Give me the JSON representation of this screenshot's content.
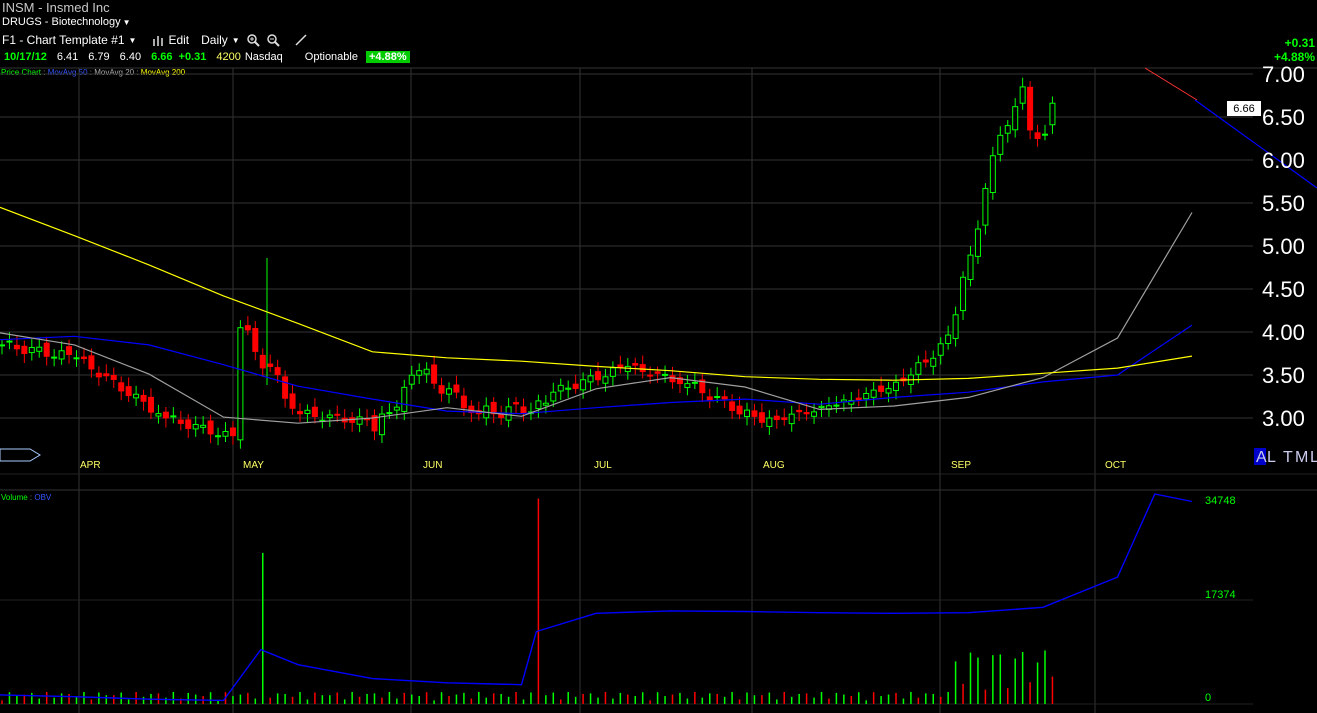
{
  "header": {
    "symbol_line": "INSM - Insmed Inc",
    "industry": "DRUGS - Biotechnology",
    "template": "F1 - Chart Template #1",
    "edit_label": "Edit",
    "period_label": "Daily",
    "price_label": "6.66",
    "price_change_top": "+0.31",
    "price_change_pct_top": "+4.88%"
  },
  "quote": {
    "date": "10/17/12",
    "open": "6.41",
    "high": "6.79",
    "low": "6.40",
    "close": "6.66",
    "change": "+0.31",
    "volume": "4200",
    "exchange": "Nasdaq",
    "optionable": "Optionable",
    "pct_badge": "+4.88%"
  },
  "legend": {
    "price_chart": "Price Chart",
    "ma50": "MovAvg 50",
    "ma20": "MovAvg 20",
    "ma200": "MovAvg 200",
    "volume": "Volume",
    "obv": "OBV"
  },
  "colors": {
    "up": "#00ff00",
    "down": "#ff0000",
    "ma50": "#0000ff",
    "ma20": "#a0a0a0",
    "ma200": "#ffff00",
    "obv": "#0000ff",
    "trendline": "#ff3333",
    "grid": "#333333"
  },
  "chart_data": [
    {
      "type": "line",
      "series": [
        {
          "name": "MovAvg 50",
          "x": [
            0,
            10,
            20,
            30,
            40,
            50,
            60,
            70,
            80,
            90,
            100,
            110,
            120,
            130,
            140,
            150,
            160
          ],
          "values": [
            3.91,
            3.95,
            3.85,
            3.62,
            3.37,
            3.22,
            3.08,
            3.05,
            3.12,
            3.18,
            3.22,
            3.16,
            3.24,
            3.3,
            3.42,
            3.5,
            4.08
          ]
        },
        {
          "name": "MovAvg 20",
          "x": [
            0,
            10,
            20,
            30,
            40,
            50,
            60,
            70,
            80,
            90,
            100,
            110,
            120,
            130,
            140,
            150,
            160
          ],
          "values": [
            3.99,
            3.85,
            3.51,
            3.01,
            2.94,
            3.0,
            3.12,
            3.02,
            3.34,
            3.47,
            3.36,
            3.1,
            3.14,
            3.24,
            3.47,
            3.93,
            5.39
          ]
        },
        {
          "name": "MovAvg 200",
          "x": [
            0,
            10,
            20,
            30,
            40,
            50,
            60,
            70,
            80,
            90,
            100,
            110,
            120,
            130,
            140,
            150,
            160
          ],
          "values": [
            5.45,
            5.12,
            4.78,
            4.42,
            4.1,
            3.77,
            3.7,
            3.66,
            3.6,
            3.55,
            3.48,
            3.45,
            3.44,
            3.46,
            3.52,
            3.58,
            3.72
          ]
        }
      ],
      "candles_approx": {
        "note_months": [
          "APR",
          "MAY",
          "JUN",
          "JUL",
          "AUG",
          "SEP",
          "OCT"
        ],
        "last": {
          "open": 6.41,
          "high": 6.79,
          "low": 6.4,
          "close": 6.66
        }
      },
      "price_ticks": [
        "7.00",
        "6.50",
        "6.00",
        "5.50",
        "5.00",
        "4.50",
        "4.00",
        "3.50",
        "3.00"
      ],
      "ylim": [
        2.8,
        7.1
      ],
      "month_labels": [
        "APR",
        "MAY",
        "JUN",
        "JUL",
        "AUG",
        "SEP",
        "OCT"
      ]
    },
    {
      "type": "line",
      "series": [
        {
          "name": "OBV",
          "x": [
            0,
            10,
            20,
            30,
            35,
            40,
            50,
            60,
            70,
            72,
            80,
            90,
            100,
            110,
            120,
            130,
            140,
            150,
            155,
            160
          ],
          "values": [
            1500,
            1200,
            800,
            600,
            9000,
            6500,
            4200,
            3500,
            3200,
            12000,
            15000,
            15400,
            15300,
            15100,
            15000,
            15100,
            16000,
            21000,
            34748,
            33500
          ]
        }
      ],
      "volume_ticks": [
        "34748",
        "17374",
        "0"
      ]
    }
  ]
}
